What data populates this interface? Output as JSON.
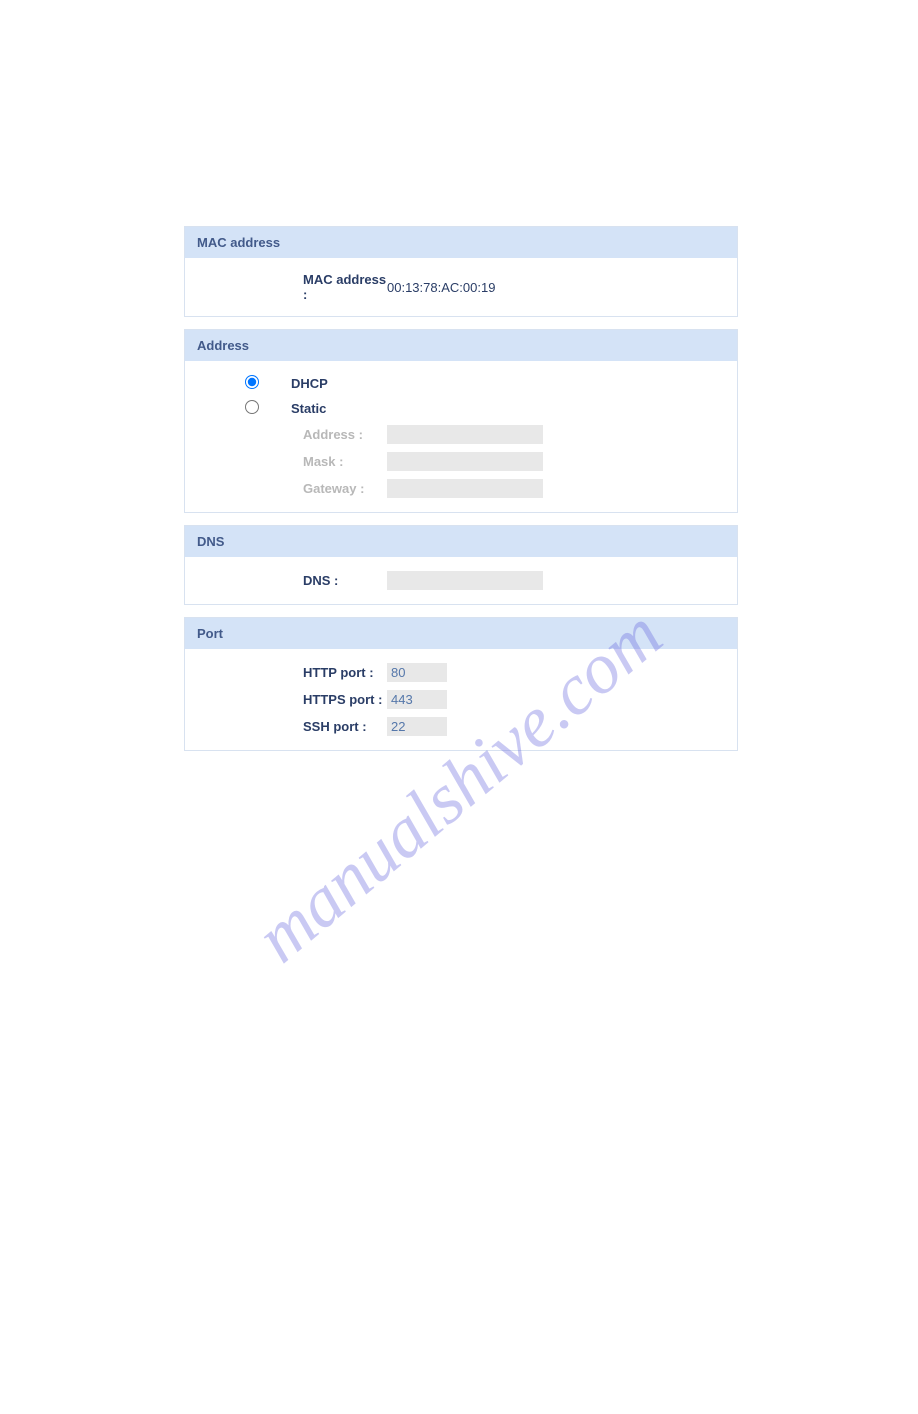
{
  "mac": {
    "header": "MAC address",
    "label": "MAC address :",
    "value": "00:13:78:AC:00:19"
  },
  "address": {
    "header": "Address",
    "dhcp_label": "DHCP",
    "static_label": "Static",
    "address_label": "Address :",
    "mask_label": "Mask :",
    "gateway_label": "Gateway :"
  },
  "dns": {
    "header": "DNS",
    "label": "DNS :"
  },
  "port": {
    "header": "Port",
    "http_label": "HTTP port :",
    "http_value": "80",
    "https_label": "HTTPS port :",
    "https_value": "443",
    "ssh_label": "SSH port :",
    "ssh_value": "22"
  },
  "watermark": "manualshive.com"
}
